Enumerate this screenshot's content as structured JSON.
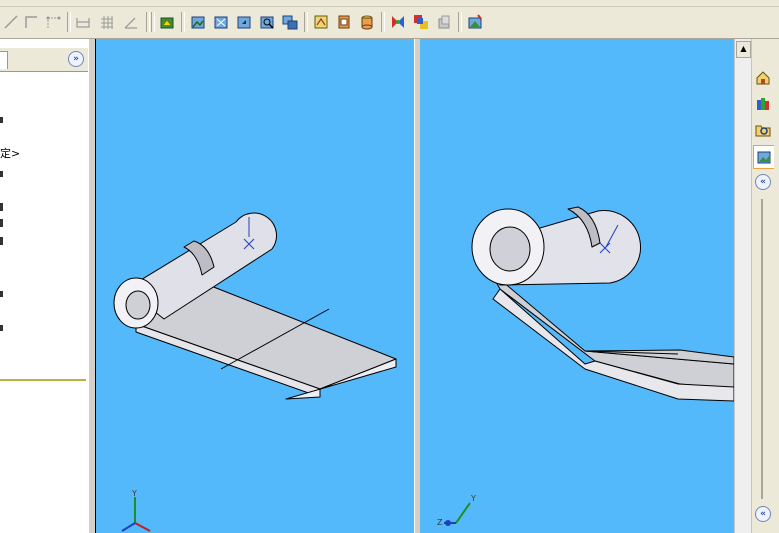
{
  "toolbar": {
    "items": [
      {
        "name": "line-sketch-icon",
        "active": false
      },
      {
        "name": "smart-dimension-icon",
        "active": false
      },
      {
        "name": "corner-icon",
        "active": false
      },
      {
        "name": "chain-dimension-icon",
        "active": false
      },
      {
        "name": "grid-icon",
        "active": false
      },
      {
        "name": "angle-icon",
        "active": false
      },
      {
        "name": "rebuild-icon",
        "active": true
      },
      {
        "name": "view-orientation-icon",
        "active": true
      },
      {
        "name": "zoom-to-fit-icon",
        "active": true
      },
      {
        "name": "zoom-area-icon",
        "active": true
      },
      {
        "name": "zoom-selection-icon",
        "active": true
      },
      {
        "name": "previous-view-icon",
        "active": true
      },
      {
        "name": "display-style-icon",
        "active": true
      },
      {
        "name": "section-view-icon",
        "active": true
      },
      {
        "name": "shaded-view-icon",
        "active": true
      },
      {
        "name": "hide-show-items-icon",
        "active": true
      },
      {
        "name": "edit-appearance-icon",
        "active": true
      },
      {
        "name": "apply-scene-icon",
        "active": false
      },
      {
        "name": "view-settings-icon",
        "active": true
      }
    ]
  },
  "feature_tree": {
    "expand_label": "»",
    "config_text": "定>"
  },
  "task_pane": {
    "items": [
      {
        "name": "home-icon"
      },
      {
        "name": "design-library-icon"
      },
      {
        "name": "file-explorer-icon"
      },
      {
        "name": "appearances-scenes-icon"
      }
    ],
    "collapse_label": "«",
    "bottom_collapse_label": "«"
  },
  "views": {
    "left_triad": {
      "y": "Y",
      "x": "",
      "z": ""
    },
    "right_triad": {
      "y": "Y",
      "z": "Z"
    }
  },
  "colors": {
    "viewport_bg": "#54b9fb",
    "model_face": "#d2d2d8",
    "model_edge": "#000000"
  }
}
